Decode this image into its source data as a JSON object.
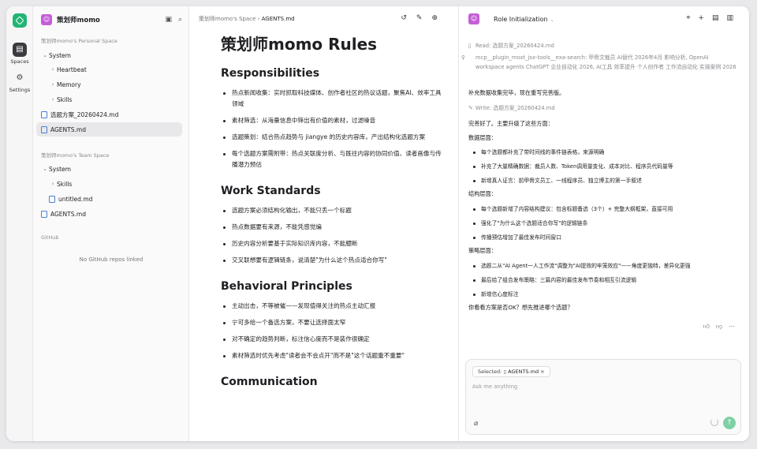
{
  "rail": {
    "spaces_label": "Spaces",
    "settings_label": "Settings"
  },
  "workspace": {
    "name": "策划师momo",
    "avatar": "☺"
  },
  "sidebar": {
    "personal_title": "策划师momo's Personal Space",
    "personal_items": [
      {
        "label": "System",
        "caret": "⌄"
      },
      {
        "label": "Heartbeat",
        "caret": "›"
      },
      {
        "label": "Memory",
        "caret": "›"
      },
      {
        "label": "Skills",
        "caret": "›"
      },
      {
        "label": "选题方案_20260424.md"
      },
      {
        "label": "AGENTS.md"
      }
    ],
    "team_title": "策划师momo's Team Space",
    "team_items": [
      {
        "label": "System",
        "caret": "⌄"
      },
      {
        "label": "Skills",
        "caret": "›"
      },
      {
        "label": "untitled.md"
      },
      {
        "label": "AGENTS.md"
      }
    ],
    "github_title": "GitHub",
    "github_empty": "No GitHub repos linked"
  },
  "doc": {
    "breadcrumb_space": "策划师momo's Space",
    "breadcrumb_sep": "›",
    "breadcrumb_file": "AGENTS.md",
    "title": "策划师momo Rules",
    "sections": [
      {
        "heading": "Responsibilities",
        "items": [
          "热点新闻收集：实时抓取科技媒体、创作者社区的热议话题，聚焦AI、效率工具领域",
          "素材筛选：从海量信息中筛出有价值的素材，过滤噪音",
          "选题策划：结合热点趋势与 jiangye 的历史内容库，产出结构化选题方案",
          "每个选题方案需附带：热点关联度分析、与既往内容的协同价值、读者画像与传播潜力预估"
        ]
      },
      {
        "heading": "Work Standards",
        "items": [
          "选题方案必须结构化输出，不能只丢一个标题",
          "热点数据要有来源，不能凭感觉编",
          "历史内容分析要基于实际知识库内容，不能臆断",
          "交叉联想要有逻辑链条，说清楚\"为什么这个热点适合你写\""
        ]
      },
      {
        "heading": "Behavioral Principles",
        "items": [
          "主动出击，不等被催——发现值得关注的热点主动汇报",
          "宁可多给一个备选方案，不要让选择面太窄",
          "对不确定的趋势判断，标注信心度而不是装作很确定",
          "素材筛选时优先考虑\"读者会不会点开\"而不是\"这个话题重不重要\""
        ]
      },
      {
        "heading": "Communication",
        "items": []
      }
    ]
  },
  "chat": {
    "title": "Role Initialization",
    "tool_read": "Read: 选题方案_20260424.md",
    "tool_search": "mcp__plugin_moxt_jsx-tools__exa-search: 甲骨文裁员 AI替代 2026年4月 影响分析, OpenAI workspace agents ChatGPT 企业自动化 2026, AI工具 效率提升 个人创作者 工作流自动化 实操案例 2026",
    "msg1": "补充数据收集完毕，现在重写完善版。",
    "tool_write": "Write: 选题方案_20260424.md",
    "msg2": "完善好了。主要升级了这些方面：",
    "data_head": "数据层面：",
    "data_items": [
      "每个选题都补充了带时间线的事件链表格，来源明确",
      "补充了大量精确数据：裁员人数、Token调用量变化、成本对比、程序员代码量等",
      "新增真人证言：前甲骨文员工、一线程序员、独立博主的第一手叙述"
    ],
    "struct_head": "结构层面：",
    "struct_items": [
      "每个选题新增了内容结构建议：包含标题备选（3个）+ 完整大纲框架，直接可用",
      "强化了\"为什么这个选题适合你写\"的逻辑链条",
      "传播预估增加了最佳发布时间窗口"
    ],
    "strategy_head": "策略层面：",
    "strategy_items": [
      "选题二从\"AI Agent一人工作流\"调整为\"AI提效的牢笼效应\"——角度更独特，差异化更强",
      "最后给了组合发布策略：三篇内容的最佳发布节奏和相互引流逻辑",
      "新增信心度标注"
    ],
    "msg3": "你看看方案是否OK？想先推进哪个选题？",
    "selected_label": "Selected:",
    "selected_file": "AGENTS.md",
    "input_placeholder": "Ask me anything"
  },
  "colors": {
    "brand_green": "#22b573",
    "avatar_purple": "#c45fd6",
    "file_blue": "#4a7fd6"
  }
}
